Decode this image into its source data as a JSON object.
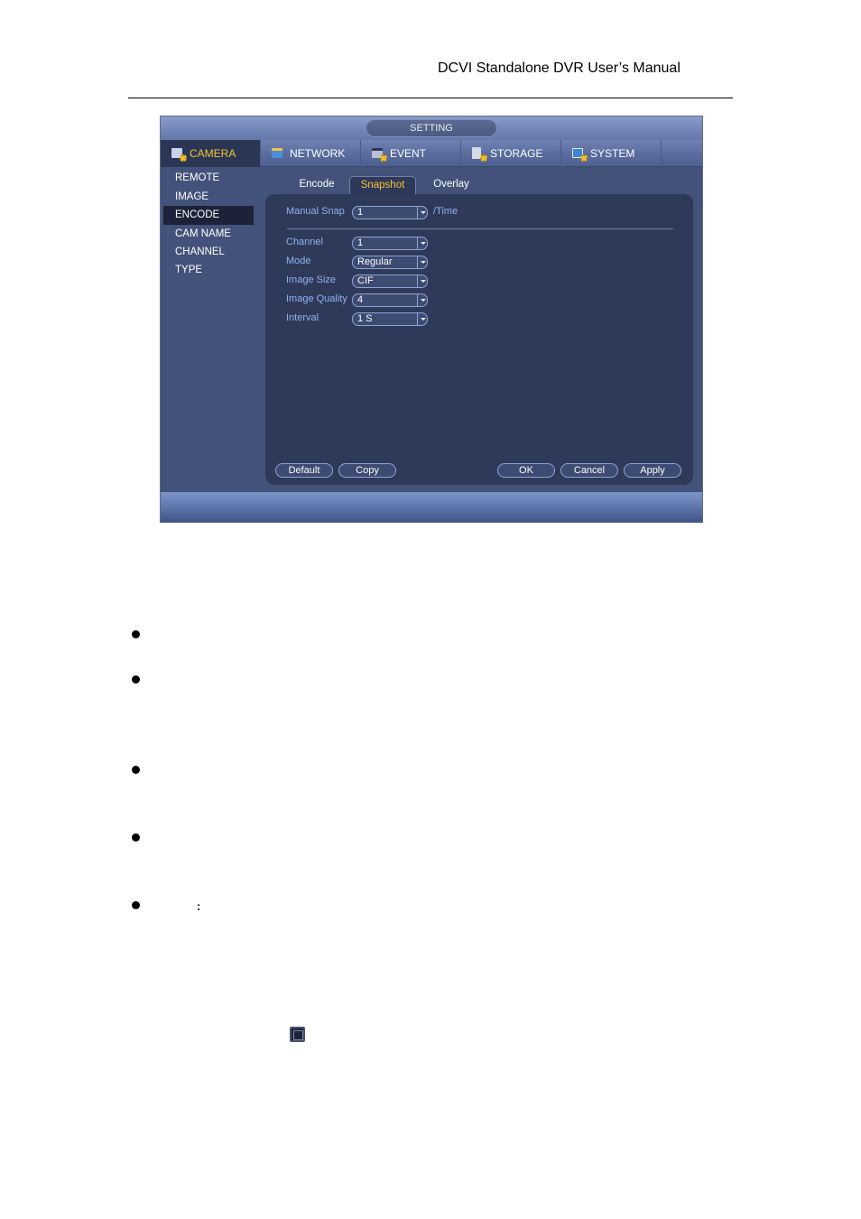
{
  "document": {
    "header": "DCVI Standalone DVR User’s Manual"
  },
  "dvr": {
    "window_title": "SETTING",
    "menu_tabs": [
      {
        "label": "CAMERA",
        "icon": "camera-gear-icon",
        "active": true
      },
      {
        "label": "NETWORK",
        "icon": "network-icon",
        "active": false
      },
      {
        "label": "EVENT",
        "icon": "event-icon",
        "active": false
      },
      {
        "label": "STORAGE",
        "icon": "storage-icon",
        "active": false
      },
      {
        "label": "SYSTEM",
        "icon": "system-monitor-icon",
        "active": false
      }
    ],
    "sidebar": [
      {
        "label": "REMOTE"
      },
      {
        "label": "IMAGE"
      },
      {
        "label": "ENCODE",
        "active": true
      },
      {
        "label": "CAM NAME"
      },
      {
        "label": "CHANNEL TYPE"
      }
    ],
    "sub_tabs": [
      {
        "label": "Encode"
      },
      {
        "label": "Snapshot",
        "active": true
      },
      {
        "label": "Overlay"
      }
    ],
    "manual_snap": {
      "label": "Manual Snap",
      "value": "1",
      "suffix": "/Time"
    },
    "fields": [
      {
        "label": "Channel",
        "value": "1"
      },
      {
        "label": "Mode",
        "value": "Regular"
      },
      {
        "label": "Image Size",
        "value": "CIF"
      },
      {
        "label": "Image Quality",
        "value": "4"
      },
      {
        "label": "Interval",
        "value": "1 S"
      }
    ],
    "buttons": {
      "default": "Default",
      "copy": "Copy",
      "ok": "OK",
      "cancel": "Cancel",
      "apply": "Apply"
    },
    "colors": {
      "accent_active": "#f2c437",
      "label_blue": "#8fb2ee",
      "panel": "#2f3a5a"
    }
  },
  "body_text": {
    "colon": ":"
  }
}
